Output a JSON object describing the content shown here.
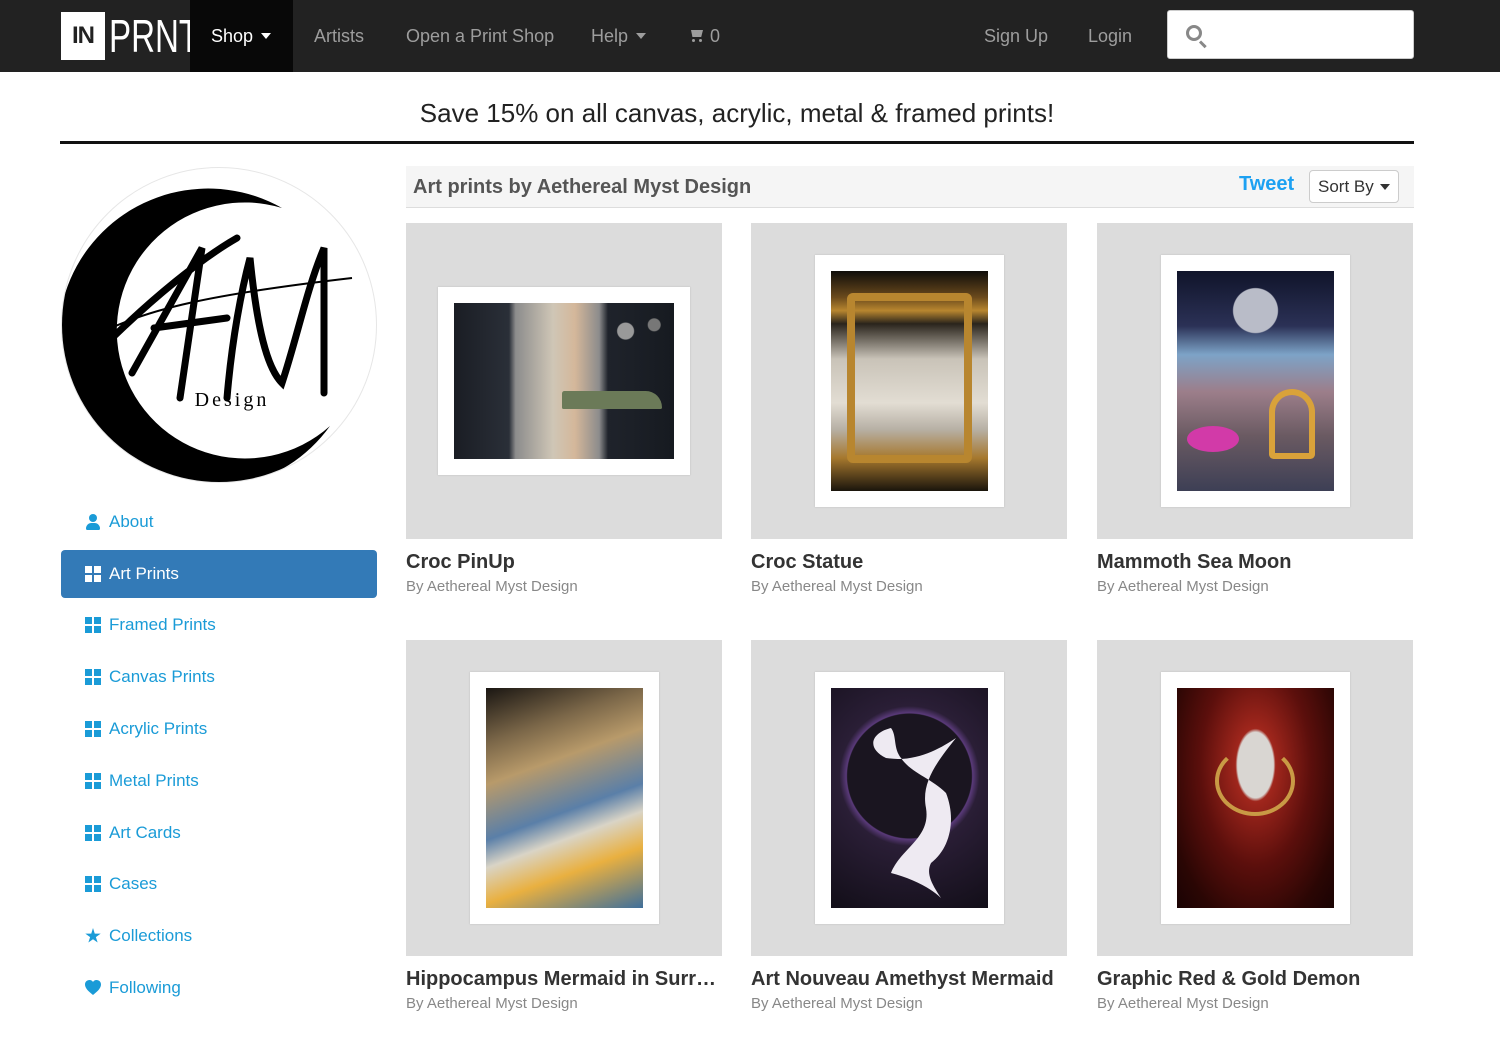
{
  "navbar": {
    "logo_in": "IN",
    "logo_prnt": "PRNT",
    "shop": "Shop",
    "artists": "Artists",
    "open_shop": "Open a Print Shop",
    "help": "Help",
    "cart_count": "0",
    "sign_up": "Sign Up",
    "login": "Login",
    "search_placeholder": ""
  },
  "promo": "Save 15% on all canvas, acrylic, metal & framed prints!",
  "avatar": {
    "monogram": "AM",
    "word": "Design"
  },
  "sidebar": {
    "items": [
      {
        "label": "About",
        "icon": "user-icon"
      },
      {
        "label": "Art Prints",
        "icon": "grid-icon",
        "active": true
      },
      {
        "label": "Framed Prints",
        "icon": "grid-icon"
      },
      {
        "label": "Canvas Prints",
        "icon": "grid-icon"
      },
      {
        "label": "Acrylic Prints",
        "icon": "grid-icon"
      },
      {
        "label": "Metal Prints",
        "icon": "grid-icon"
      },
      {
        "label": "Art Cards",
        "icon": "grid-icon"
      },
      {
        "label": "Cases",
        "icon": "grid-icon"
      },
      {
        "label": "Collections",
        "icon": "star-icon"
      },
      {
        "label": "Following",
        "icon": "heart-icon"
      }
    ]
  },
  "main": {
    "title": "Art prints by Aethereal Myst Design",
    "tweet": "Tweet",
    "sort": "Sort By"
  },
  "prints": [
    {
      "name": "Croc PinUp",
      "by": "By Aethereal Myst Design"
    },
    {
      "name": "Croc Statue",
      "by": "By Aethereal Myst Design"
    },
    {
      "name": "Mammoth Sea Moon",
      "by": "By Aethereal Myst Design"
    },
    {
      "name": "Hippocampus Mermaid in Surr…",
      "by": "By Aethereal Myst Design"
    },
    {
      "name": "Art Nouveau Amethyst Mermaid",
      "by": "By Aethereal Myst Design"
    },
    {
      "name": "Graphic Red & Gold Demon",
      "by": "By Aethereal Myst Design"
    }
  ],
  "colors": {
    "nav_bg": "#222222",
    "active": "#337ab7",
    "link": "#1a9bd7",
    "tweet": "#1da1f2"
  }
}
